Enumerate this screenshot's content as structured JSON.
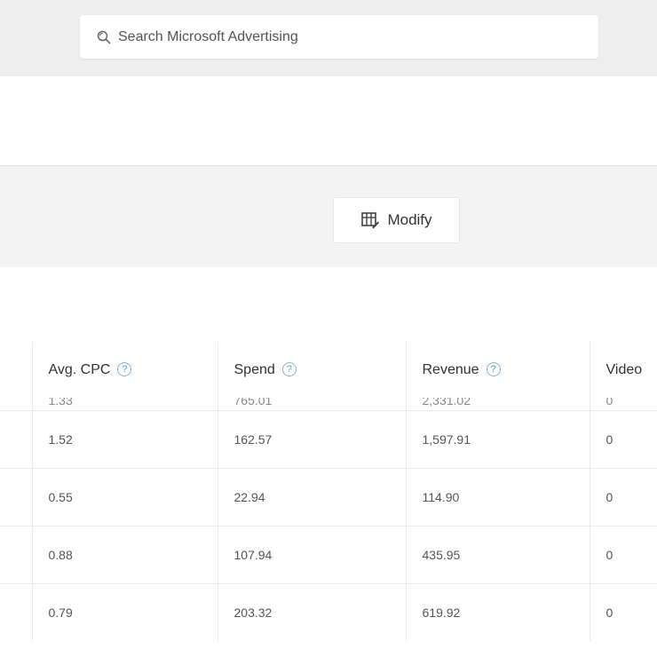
{
  "search": {
    "placeholder": "Search Microsoft Advertising"
  },
  "toolbar": {
    "modify_label": "Modify"
  },
  "table": {
    "columns": [
      {
        "label": "Avg. CPC",
        "help": "?"
      },
      {
        "label": "Spend",
        "help": "?"
      },
      {
        "label": "Revenue",
        "help": "?"
      },
      {
        "label": "Video"
      }
    ],
    "partial_row": [
      "1.33",
      "765.01",
      "2,331.02",
      "0"
    ],
    "rows": [
      [
        "1.52",
        "162.57",
        "1,597.91",
        "0"
      ],
      [
        "0.55",
        "22.94",
        "114.90",
        "0"
      ],
      [
        "0.88",
        "107.94",
        "435.95",
        "0"
      ],
      [
        "0.79",
        "203.32",
        "619.92",
        "0"
      ]
    ]
  }
}
